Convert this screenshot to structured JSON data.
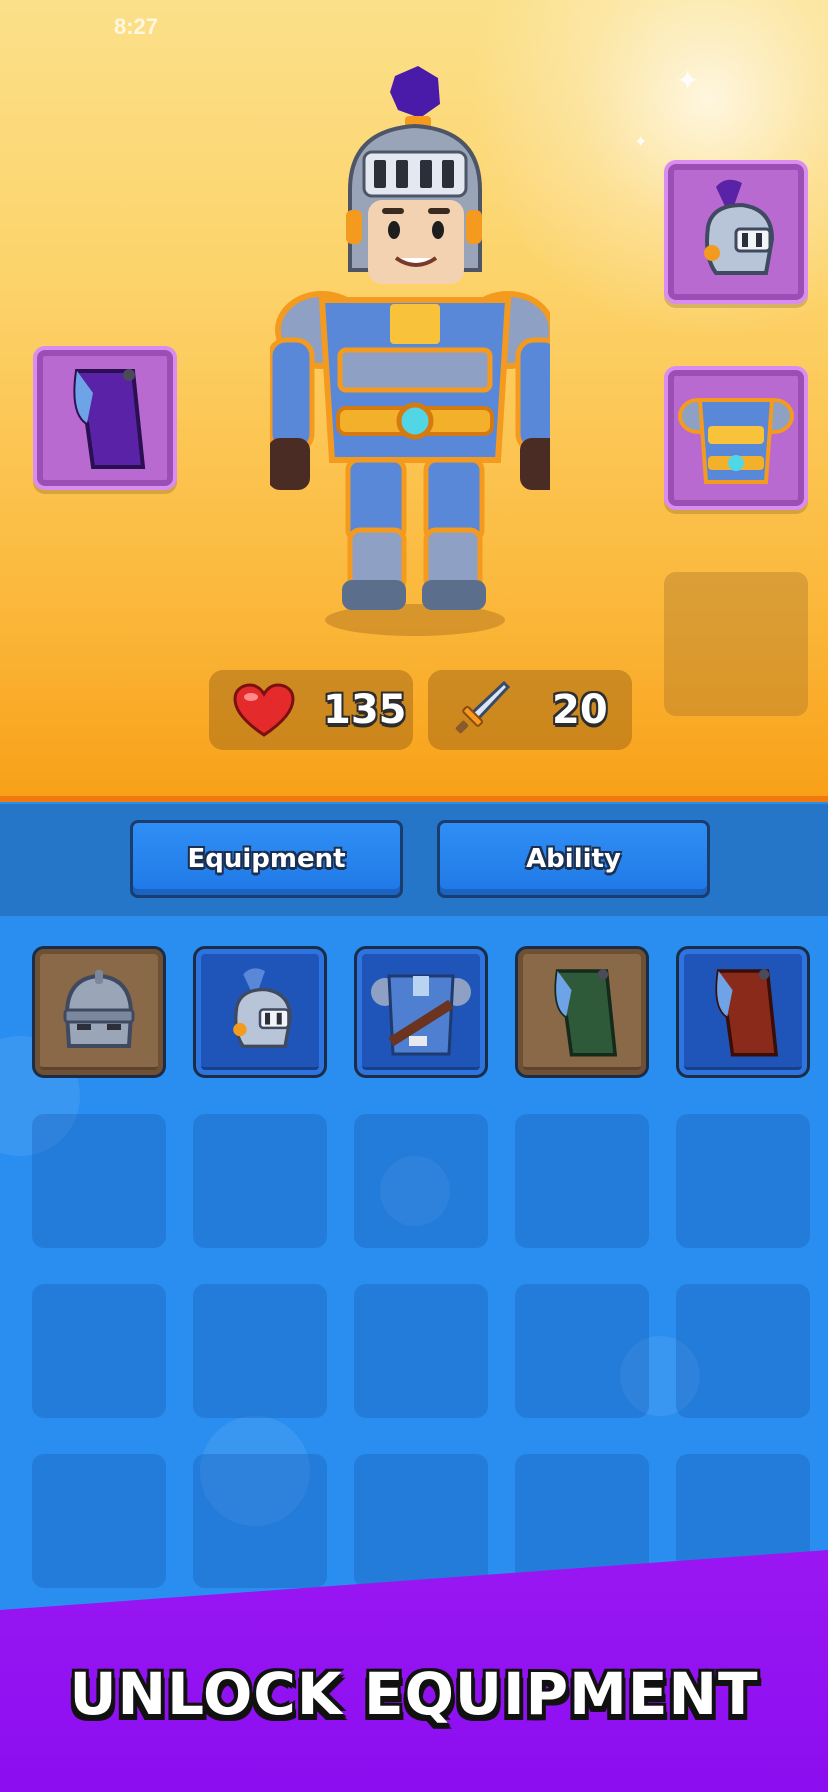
{
  "status_bar": {
    "time": "8:27"
  },
  "stats": {
    "health": {
      "value": "135",
      "icon": "heart-icon"
    },
    "attack": {
      "value": "20",
      "icon": "sword-icon"
    }
  },
  "equipped_slots": [
    {
      "slot": "cape",
      "icon": "purple-cape-icon"
    },
    {
      "slot": "helmet",
      "icon": "plumed-helmet-icon"
    },
    {
      "slot": "armor",
      "icon": "gold-armor-icon"
    },
    {
      "slot": "empty",
      "icon": ""
    }
  ],
  "tabs": [
    {
      "label": "Equipment"
    },
    {
      "label": "Ability"
    }
  ],
  "inventory": {
    "items": [
      {
        "icon": "iron-helmet-icon",
        "rarity": "common"
      },
      {
        "icon": "plumed-helmet-icon",
        "rarity": "rare"
      },
      {
        "icon": "blue-tunic-icon",
        "rarity": "rare"
      },
      {
        "icon": "green-cape-icon",
        "rarity": "common"
      },
      {
        "icon": "red-cape-icon",
        "rarity": "rare"
      }
    ]
  },
  "banner": {
    "text": "UNLOCK EQUIPMENT"
  },
  "colors": {
    "hero_bg_top": "#fbe08a",
    "hero_bg_bottom": "#f8a017",
    "slot_purple": "#b96ad0",
    "tab_blue": "#1f78e6",
    "inventory_bg": "#2a8ef0",
    "rarity_common": "#8a6948",
    "rarity_rare": "#1f55b8",
    "banner_purple": "#8a0df0"
  }
}
